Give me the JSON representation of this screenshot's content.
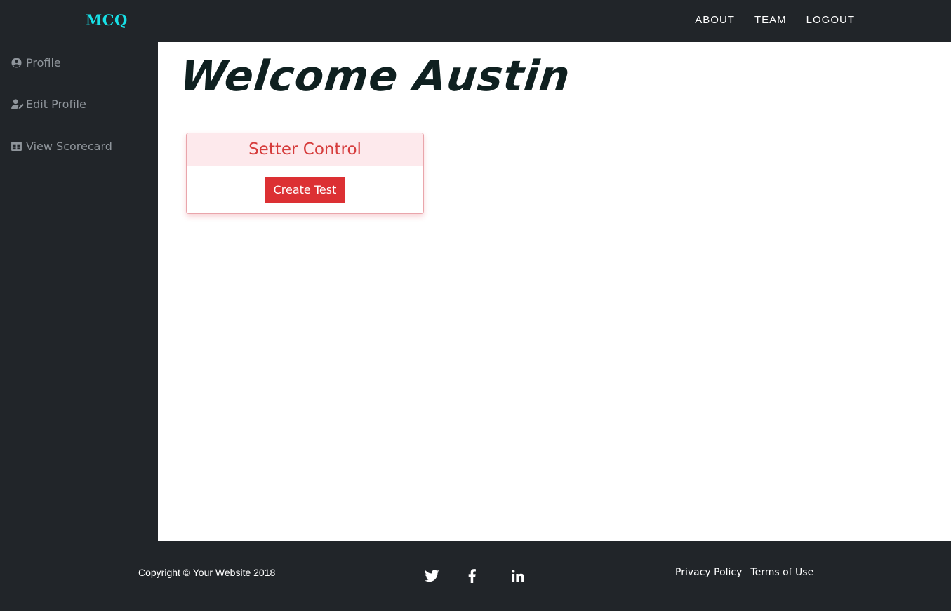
{
  "navbar": {
    "brand": "MCQ",
    "links": [
      {
        "label": "ABOUT"
      },
      {
        "label": "TEAM"
      },
      {
        "label": "LOGOUT"
      }
    ]
  },
  "sidebar": {
    "items": [
      {
        "label": "Profile",
        "icon": "user-circle-icon"
      },
      {
        "label": "Edit Profile",
        "icon": "user-edit-icon"
      },
      {
        "label": "View Scorecard",
        "icon": "table-icon"
      }
    ]
  },
  "main": {
    "welcome": "Welcome Austin",
    "card": {
      "title": "Setter Control",
      "button_label": "Create Test"
    }
  },
  "footer": {
    "copyright": "Copyright © Your Website 2018",
    "social": [
      "twitter-icon",
      "facebook-icon",
      "linkedin-icon"
    ],
    "links": [
      {
        "label": "Privacy Policy"
      },
      {
        "label": "Terms of Use"
      }
    ]
  },
  "colors": {
    "brand": "#17e0e6",
    "dark_bg": "#212529",
    "danger": "#dc3033",
    "card_header_bg": "#fde9ec",
    "card_title": "#d63c3c"
  }
}
